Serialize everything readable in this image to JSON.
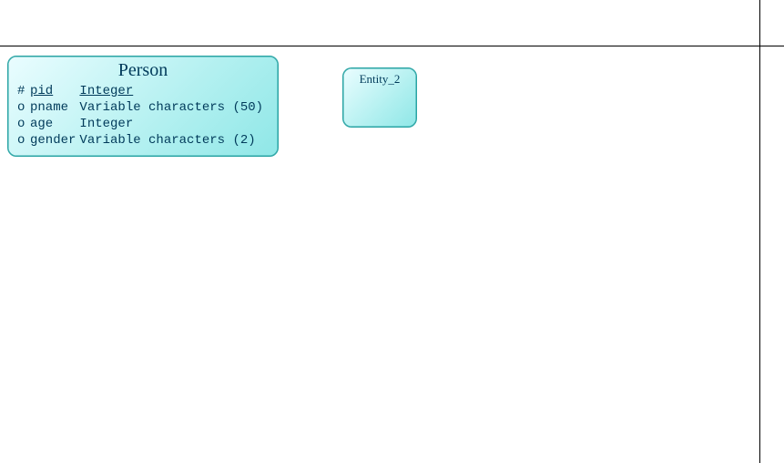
{
  "entities": {
    "person": {
      "title": "Person",
      "attrs": [
        {
          "marker": "#",
          "name": "pid",
          "type": "Integer",
          "pk": true
        },
        {
          "marker": "o",
          "name": "pname",
          "type": "Variable characters (50)",
          "pk": false
        },
        {
          "marker": "o",
          "name": "age",
          "type": "Integer",
          "pk": false
        },
        {
          "marker": "o",
          "name": "gender",
          "type": "Variable characters (2)",
          "pk": false
        }
      ]
    },
    "entity2": {
      "title": "Entity_2"
    }
  }
}
